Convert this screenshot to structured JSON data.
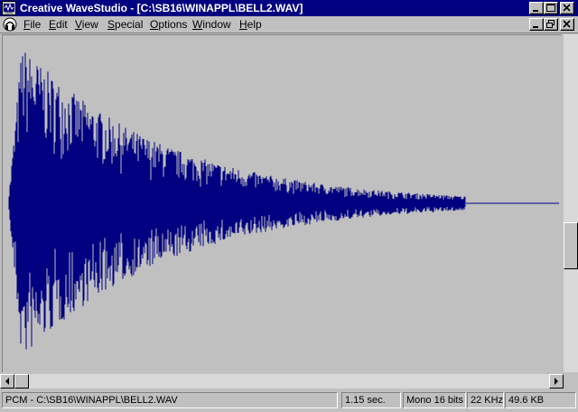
{
  "window": {
    "title": "Creative WaveStudio - [C:\\SB16\\WINAPPL\\BELL2.WAV]"
  },
  "menu": [
    {
      "label": "File",
      "accel": "F",
      "rest": "ile"
    },
    {
      "label": "Edit",
      "accel": "E",
      "rest": "dit"
    },
    {
      "label": "View",
      "accel": "V",
      "rest": "iew"
    },
    {
      "label": "Special",
      "accel": "S",
      "rest": "pecial"
    },
    {
      "label": "Options",
      "accel": "O",
      "rest": "ptions"
    },
    {
      "label": "Window",
      "accel": "W",
      "rest": "indow"
    },
    {
      "label": "Help",
      "accel": "H",
      "rest": "elp"
    }
  ],
  "waveform": {
    "color": "#000080",
    "duration_fraction_shown": 0.83
  },
  "status": {
    "file": "PCM - C:\\SB16\\WINAPPL\\BELL2.WAV",
    "length": "1.15 sec.",
    "format": "Mono 16 bits",
    "rate": "22 KHz",
    "size": "49.6 KB"
  },
  "colors": {
    "titlebar": "#000080",
    "face": "#c0c0c0",
    "wave": "#000080"
  }
}
